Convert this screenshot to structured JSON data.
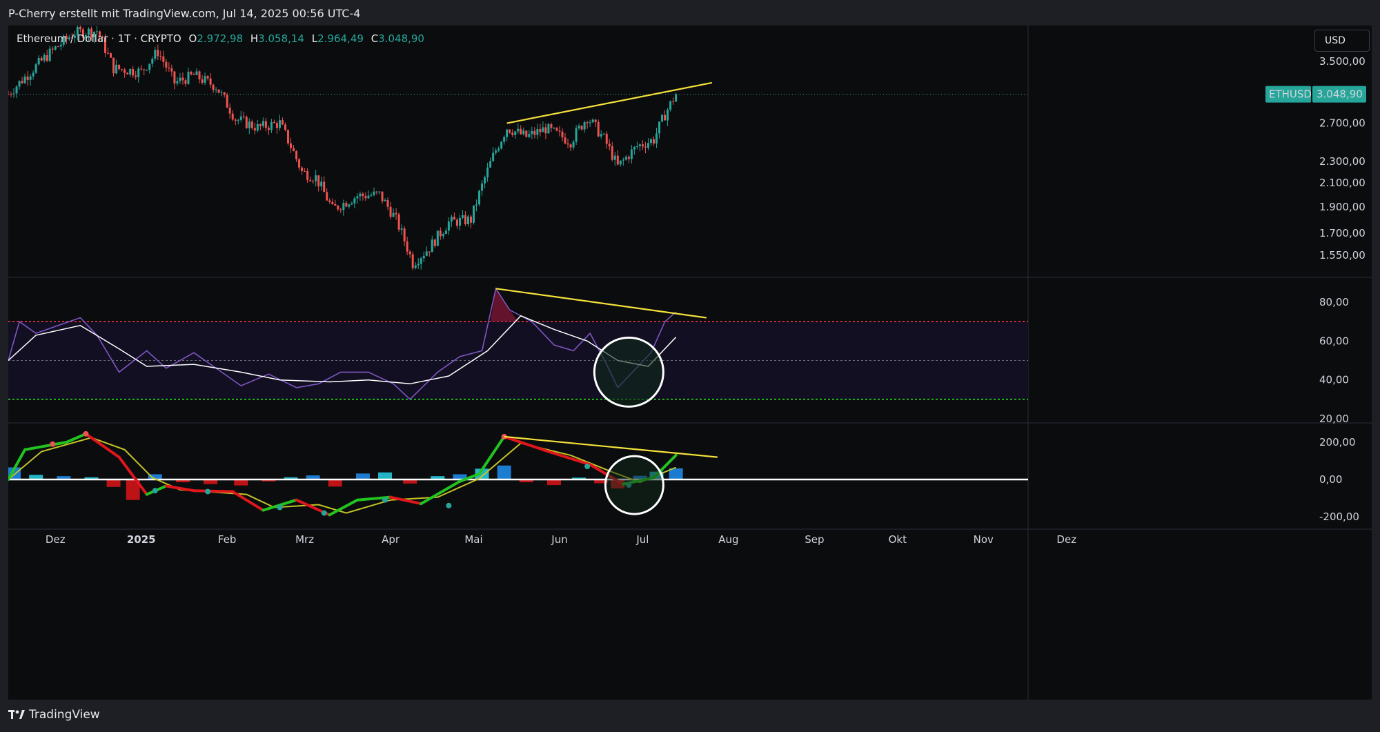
{
  "header": {
    "attribution": "P-Cherry erstellt mit TradingView.com, Jul 14, 2025 00:56 UTC-4"
  },
  "legend": {
    "symbol": "Ethereum / Dollar · 1T · CRYPTO",
    "o_label": "O",
    "o_value": "2.972,98",
    "h_label": "H",
    "h_value": "3.058,14",
    "l_label": "L",
    "l_value": "2.964,49",
    "c_label": "C",
    "c_value": "3.048,90"
  },
  "currency_button": "USD",
  "price_tag": {
    "symbol": "ETHUSD",
    "value": "3.048,90"
  },
  "footer": {
    "brand": "TradingView"
  },
  "colors": {
    "up": "#26a69a",
    "down": "#ef5350",
    "trendline": "#f5e23b",
    "rsi": "#7e57c2",
    "rsi_ma": "#ffffff",
    "overbought": "#f23645",
    "oversold": "#22c41f",
    "macd_up": "#22c41f",
    "macd_down": "#e0161d",
    "signal": "#c4c428"
  },
  "chart_data": [
    {
      "type": "candlestick",
      "title": "Ethereum / Dollar · 1T · CRYPTO",
      "x_ticks": [
        "Dez",
        "2025",
        "Feb",
        "Mrz",
        "Apr",
        "Mai",
        "Jun",
        "Jul",
        "Aug",
        "Sep",
        "Okt",
        "Nov",
        "Dez"
      ],
      "y_ticks": [
        "3.500,00",
        "2.700,00",
        "2.300,00",
        "2.100,00",
        "1.900,00",
        "1.700,00",
        "1.550,00"
      ],
      "y_scale": "log",
      "last_price": 3048.9,
      "close_path": [
        [
          "2024-11-14",
          3050
        ],
        [
          "2024-11-22",
          3350
        ],
        [
          "2024-12-01",
          3700
        ],
        [
          "2024-12-08",
          3950
        ],
        [
          "2024-12-16",
          3980
        ],
        [
          "2024-12-22",
          3400
        ],
        [
          "2025-01-01",
          3350
        ],
        [
          "2025-01-07",
          3650
        ],
        [
          "2025-01-13",
          3200
        ],
        [
          "2025-01-20",
          3300
        ],
        [
          "2025-01-28",
          3150
        ],
        [
          "2025-02-04",
          2750
        ],
        [
          "2025-02-12",
          2650
        ],
        [
          "2025-02-20",
          2700
        ],
        [
          "2025-02-28",
          2200
        ],
        [
          "2025-03-05",
          2150
        ],
        [
          "2025-03-11",
          1880
        ],
        [
          "2025-03-20",
          1990
        ],
        [
          "2025-03-28",
          2000
        ],
        [
          "2025-04-03",
          1800
        ],
        [
          "2025-04-09",
          1500
        ],
        [
          "2025-04-15",
          1600
        ],
        [
          "2025-04-22",
          1780
        ],
        [
          "2025-04-30",
          1800
        ],
        [
          "2025-05-08",
          2350
        ],
        [
          "2025-05-13",
          2650
        ],
        [
          "2025-05-20",
          2550
        ],
        [
          "2025-05-27",
          2640
        ],
        [
          "2025-06-05",
          2500
        ],
        [
          "2025-06-11",
          2770
        ],
        [
          "2025-06-17",
          2530
        ],
        [
          "2025-06-22",
          2250
        ],
        [
          "2025-06-29",
          2450
        ],
        [
          "2025-07-05",
          2520
        ],
        [
          "2025-07-09",
          2800
        ],
        [
          "2025-07-13",
          3049
        ]
      ],
      "trendline": [
        [
          "2025-05-13",
          2700
        ],
        [
          "2025-07-26",
          3200
        ]
      ]
    },
    {
      "type": "line",
      "title": "RSI",
      "y_ticks": [
        "80,00",
        "60,00",
        "40,00",
        "20,00"
      ],
      "levels": {
        "overbought": 70,
        "middle": 50,
        "oversold": 30
      },
      "series": [
        {
          "values": [
            [
              "2024-11-14",
              50
            ],
            [
              "2024-11-18",
              70
            ],
            [
              "2024-11-24",
              64
            ],
            [
              "2024-12-02",
              68
            ],
            [
              "2024-12-10",
              72
            ],
            [
              "2024-12-16",
              63
            ],
            [
              "2024-12-24",
              44
            ],
            [
              "2025-01-03",
              55
            ],
            [
              "2025-01-10",
              46
            ],
            [
              "2025-01-20",
              54
            ],
            [
              "2025-01-30",
              44
            ],
            [
              "2025-02-06",
              37
            ],
            [
              "2025-02-16",
              43
            ],
            [
              "2025-02-26",
              36
            ],
            [
              "2025-03-06",
              38
            ],
            [
              "2025-03-14",
              44
            ],
            [
              "2025-03-24",
              44
            ],
            [
              "2025-04-02",
              38
            ],
            [
              "2025-04-08",
              30
            ],
            [
              "2025-04-18",
              44
            ],
            [
              "2025-04-26",
              52
            ],
            [
              "2025-05-04",
              55
            ],
            [
              "2025-05-09",
              87
            ],
            [
              "2025-05-14",
              76
            ],
            [
              "2025-05-22",
              70
            ],
            [
              "2025-05-30",
              58
            ],
            [
              "2025-06-06",
              55
            ],
            [
              "2025-06-12",
              64
            ],
            [
              "2025-06-18",
              48
            ],
            [
              "2025-06-22",
              36
            ],
            [
              "2025-06-30",
              48
            ],
            [
              "2025-07-04",
              54
            ],
            [
              "2025-07-09",
              70
            ],
            [
              "2025-07-13",
              75
            ]
          ]
        },
        {
          "values": [
            [
              "2024-11-14",
              50
            ],
            [
              "2024-11-24",
              63
            ],
            [
              "2024-12-10",
              68
            ],
            [
              "2024-12-24",
              56
            ],
            [
              "2025-01-03",
              47
            ],
            [
              "2025-01-20",
              48
            ],
            [
              "2025-02-06",
              44
            ],
            [
              "2025-02-20",
              40
            ],
            [
              "2025-03-10",
              39
            ],
            [
              "2025-03-24",
              40
            ],
            [
              "2025-04-08",
              38
            ],
            [
              "2025-04-22",
              42
            ],
            [
              "2025-05-06",
              55
            ],
            [
              "2025-05-18",
              73
            ],
            [
              "2025-05-30",
              66
            ],
            [
              "2025-06-11",
              60
            ],
            [
              "2025-06-22",
              50
            ],
            [
              "2025-07-03",
              47
            ],
            [
              "2025-07-13",
              62
            ]
          ]
        }
      ],
      "trendline": [
        [
          "2025-05-09",
          87
        ],
        [
          "2025-07-24",
          72
        ]
      ]
    },
    {
      "type": "line",
      "title": "MACD",
      "y_ticks": [
        "200,00",
        "0,00",
        "-200,00"
      ],
      "series": [
        {
          "values": [
            [
              "2024-11-14",
              0
            ],
            [
              "2024-11-20",
              160
            ],
            [
              "2024-12-05",
              200
            ],
            [
              "2024-12-12",
              245
            ],
            [
              "2024-12-24",
              120
            ],
            [
              "2025-01-03",
              -80
            ],
            [
              "2025-01-10",
              -35
            ],
            [
              "2025-01-20",
              -60
            ],
            [
              "2025-02-03",
              -65
            ],
            [
              "2025-02-14",
              -165
            ],
            [
              "2025-02-26",
              -110
            ],
            [
              "2025-03-10",
              -190
            ],
            [
              "2025-03-20",
              -110
            ],
            [
              "2025-04-01",
              -95
            ],
            [
              "2025-04-12",
              -130
            ],
            [
              "2025-04-26",
              -10
            ],
            [
              "2025-05-03",
              30
            ],
            [
              "2025-05-12",
              230
            ],
            [
              "2025-05-28",
              150
            ],
            [
              "2025-06-12",
              80
            ],
            [
              "2025-06-24",
              -25
            ],
            [
              "2025-07-05",
              10
            ],
            [
              "2025-07-13",
              130
            ]
          ]
        },
        {
          "values": [
            [
              "2024-11-14",
              0
            ],
            [
              "2024-11-26",
              150
            ],
            [
              "2024-12-14",
              225
            ],
            [
              "2024-12-26",
              160
            ],
            [
              "2025-01-05",
              10
            ],
            [
              "2025-01-15",
              -55
            ],
            [
              "2025-02-08",
              -80
            ],
            [
              "2025-02-18",
              -150
            ],
            [
              "2025-03-06",
              -135
            ],
            [
              "2025-03-16",
              -180
            ],
            [
              "2025-04-01",
              -110
            ],
            [
              "2025-04-18",
              -95
            ],
            [
              "2025-05-03",
              5
            ],
            [
              "2025-05-18",
              195
            ],
            [
              "2025-06-05",
              130
            ],
            [
              "2025-06-20",
              40
            ],
            [
              "2025-06-30",
              -15
            ],
            [
              "2025-07-13",
              65
            ]
          ]
        }
      ],
      "histogram": [
        [
          "2024-11-16",
          65
        ],
        [
          "2024-11-24",
          25
        ],
        [
          "2024-12-04",
          18
        ],
        [
          "2024-12-14",
          12
        ],
        [
          "2024-12-22",
          -40
        ],
        [
          "2024-12-29",
          -110
        ],
        [
          "2025-01-06",
          28
        ],
        [
          "2025-01-16",
          -15
        ],
        [
          "2025-01-26",
          -25
        ],
        [
          "2025-02-06",
          -32
        ],
        [
          "2025-02-16",
          -10
        ],
        [
          "2025-02-24",
          12
        ],
        [
          "2025-03-04",
          22
        ],
        [
          "2025-03-12",
          -38
        ],
        [
          "2025-03-22",
          32
        ],
        [
          "2025-03-30",
          38
        ],
        [
          "2025-04-08",
          -22
        ],
        [
          "2025-04-18",
          18
        ],
        [
          "2025-04-26",
          28
        ],
        [
          "2025-05-04",
          58
        ],
        [
          "2025-05-12",
          75
        ],
        [
          "2025-05-20",
          -15
        ],
        [
          "2025-05-30",
          -30
        ],
        [
          "2025-06-08",
          10
        ],
        [
          "2025-06-16",
          -20
        ],
        [
          "2025-06-22",
          -48
        ],
        [
          "2025-06-30",
          20
        ],
        [
          "2025-07-06",
          42
        ],
        [
          "2025-07-13",
          60
        ]
      ],
      "trendline": [
        [
          "2025-05-12",
          230
        ],
        [
          "2025-07-28",
          120
        ]
      ]
    }
  ]
}
